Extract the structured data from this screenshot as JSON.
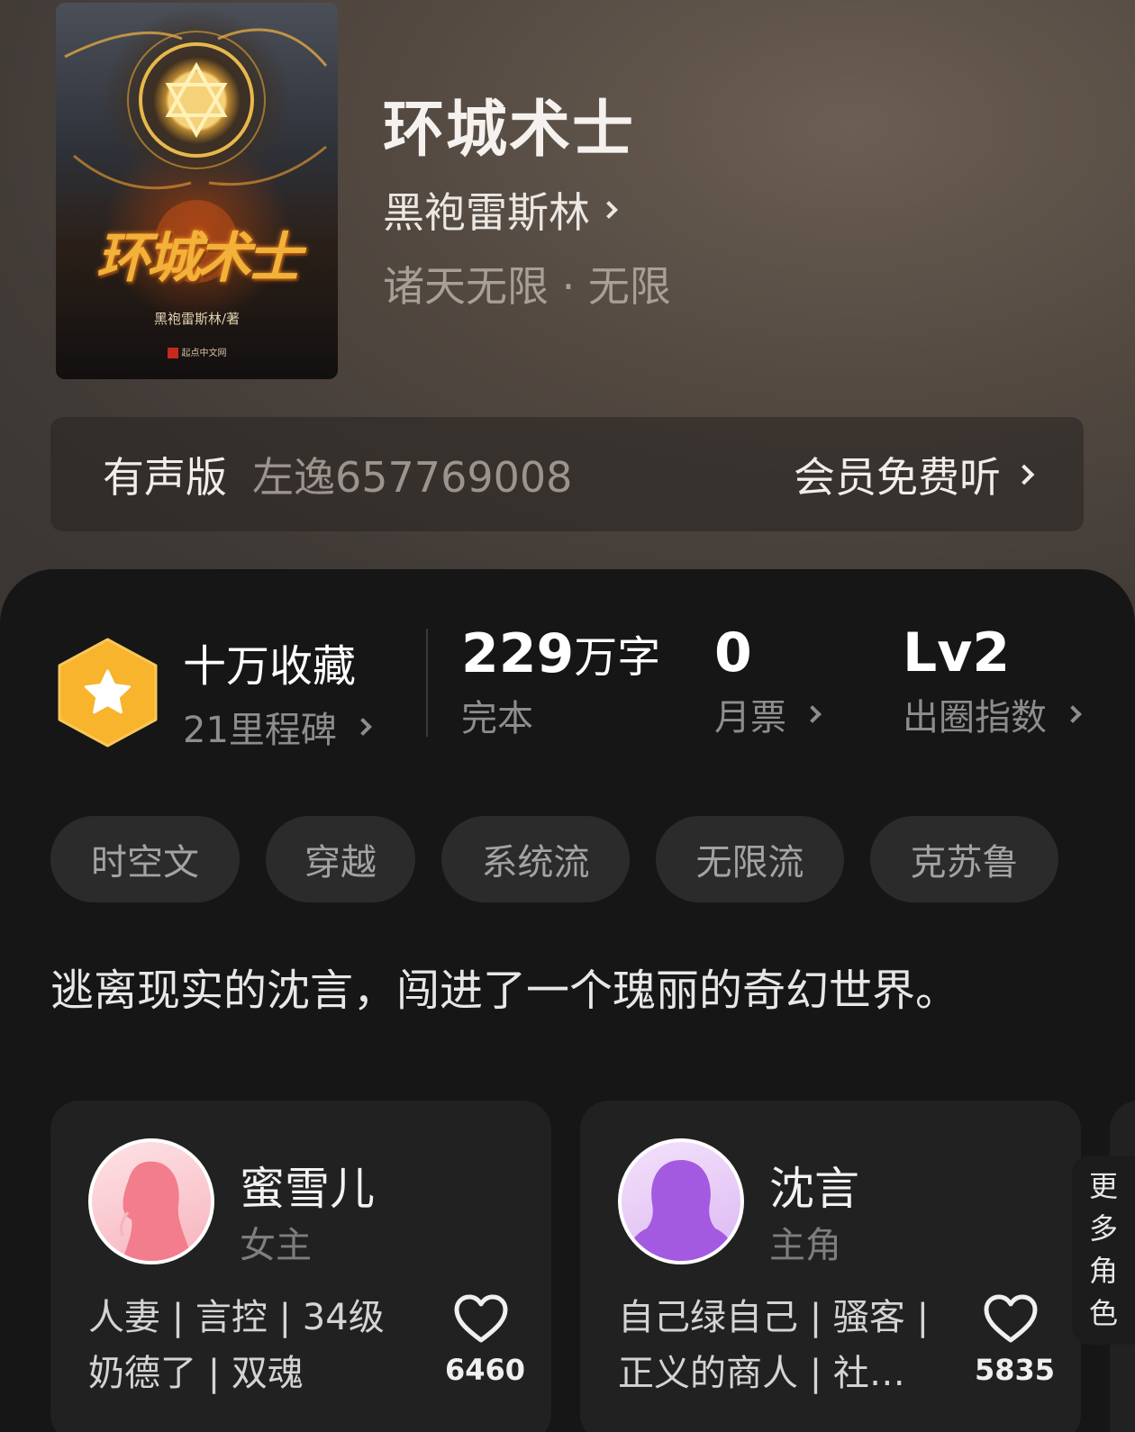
{
  "book": {
    "title": "环城术士",
    "author": "黑袍雷斯林",
    "genre": "诸天无限 · 无限",
    "cover": {
      "title": "环城术士",
      "author": "黑袍雷斯林/著",
      "publisher": "起点中文网"
    }
  },
  "audio": {
    "label": "有声版",
    "narrator": "左逸657769008",
    "action": "会员免费听"
  },
  "stats": {
    "collection": {
      "main": "十万收藏",
      "sub": "21里程碑"
    },
    "words": {
      "number": "229",
      "unit": "万字",
      "sub": "完本"
    },
    "tickets": {
      "number": "0",
      "sub": "月票"
    },
    "index": {
      "number": "Lv2",
      "sub": "出圈指数"
    }
  },
  "tags": [
    "时空文",
    "穿越",
    "系统流",
    "无限流",
    "克苏鲁"
  ],
  "synopsis": "逃离现实的沈言，闯进了一个瑰丽的奇幻世界。",
  "characters": [
    {
      "name": "蜜雪儿",
      "role": "女主",
      "traits_line1": "人妻 | 言控 | 34级",
      "traits_line2": "奶德了 | 双魂",
      "likes": "6460"
    },
    {
      "name": "沈言",
      "role": "主角",
      "traits_line1": "自己绿自己 | 骚客 |",
      "traits_line2": "正义的商人 | 社…",
      "likes": "5835"
    }
  ],
  "more_characters": [
    "更",
    "多",
    "角",
    "色"
  ],
  "colors": {
    "badge": "#f7b42c",
    "female_avatar": "#f27d8c",
    "male_avatar": "#a35ae0"
  }
}
